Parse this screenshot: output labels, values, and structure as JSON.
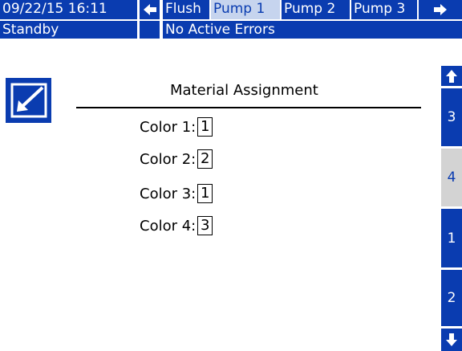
{
  "header": {
    "datetime": "09/22/15 16:11",
    "tabs": [
      {
        "label": "Flush"
      },
      {
        "label": "Pump 1"
      },
      {
        "label": "Pump 2"
      },
      {
        "label": "Pump 3"
      }
    ],
    "active_tab": "Pump 1"
  },
  "status": {
    "mode": "Standby",
    "errors": "No Active Errors"
  },
  "main": {
    "title": "Material Assignment",
    "rows": [
      {
        "label": "Color 1:",
        "value": "1"
      },
      {
        "label": "Color 2:",
        "value": "2"
      },
      {
        "label": "Color 3:",
        "value": "1"
      },
      {
        "label": "Color 4:",
        "value": "3"
      }
    ]
  },
  "sidebar": {
    "items": [
      "3",
      "4",
      "1",
      "2"
    ],
    "selected": "4"
  },
  "colors": {
    "brand_blue": "#0a3cb0",
    "active_tab_bg": "#c6d4ee",
    "selected_side_bg": "#d3d3d3"
  },
  "icons": [
    "left-arrow-icon",
    "right-arrow-icon",
    "up-arrow-icon",
    "down-arrow-icon",
    "edit-icon"
  ]
}
